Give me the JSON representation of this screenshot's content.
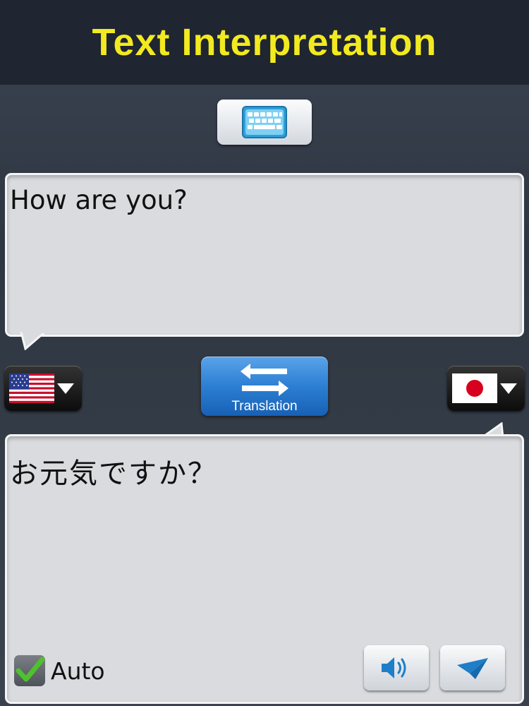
{
  "header": {
    "title": "Text Interpretation"
  },
  "keyboard_button": {
    "icon": "keyboard-icon"
  },
  "source": {
    "text": "How are you?",
    "language_flag": "us-flag-icon"
  },
  "target": {
    "text": "お元気ですか？",
    "language_flag": "japan-flag-icon"
  },
  "translate_button": {
    "label": "Translation",
    "icon": "swap-arrows-icon"
  },
  "auto": {
    "label": "Auto",
    "checked": true
  },
  "actions": {
    "speak_icon": "speaker-icon",
    "send_icon": "paper-plane-icon"
  },
  "colors": {
    "title": "#f2ea1f",
    "header_bg": "#1f2531",
    "accent_blue": "#2c7fd3",
    "bubble_bg": "#d9dbde"
  }
}
